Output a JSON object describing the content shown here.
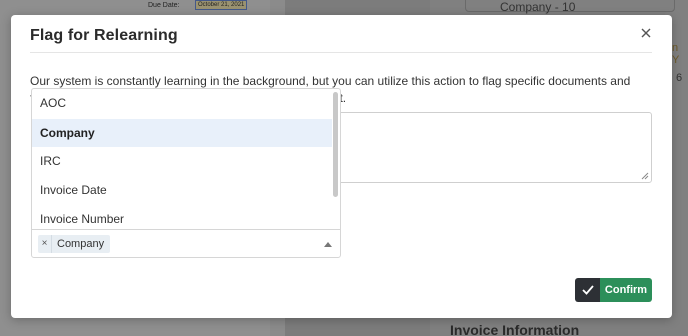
{
  "background": {
    "due_date_label": "Due Date:",
    "due_date_value": "October 21, 2021",
    "company_field_label": "Company - 10",
    "side_text_1": "n Y",
    "side_text_2": "6",
    "bottom_text": "Invoice Information"
  },
  "modal": {
    "title": "Flag for Relearning",
    "description": "Our system is constantly learning in the background, but you can utilize this action to flag specific documents and fields that we will manually review as a part of your support."
  },
  "dropdown": {
    "options": [
      {
        "label": "AOC"
      },
      {
        "label": "Company"
      },
      {
        "label": "IRC"
      },
      {
        "label": "Invoice Date"
      },
      {
        "label": "Invoice Number"
      }
    ],
    "selected_index": 1,
    "selected_tags": [
      {
        "label": "Company",
        "remove_glyph": "×"
      }
    ]
  },
  "actions": {
    "confirm_label": "Confirm"
  },
  "colors": {
    "confirm_green": "#2c8f5a",
    "confirm_icon_bg": "#2d3035",
    "selected_option_bg": "#e8f0fa"
  },
  "icons": {
    "close": "close-icon",
    "check": "check-icon",
    "dropdown_arrow": "chevron-up-icon"
  }
}
